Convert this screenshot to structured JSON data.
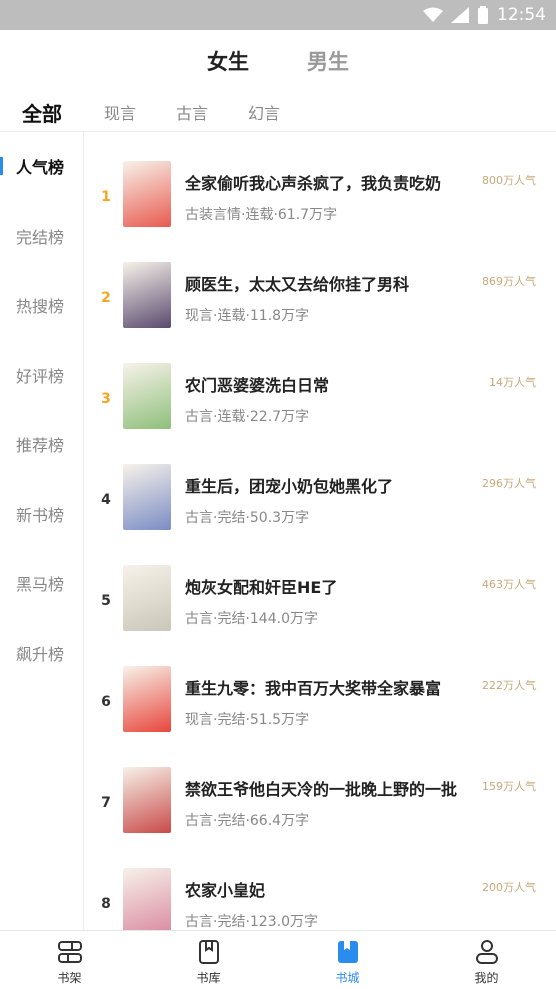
{
  "status": {
    "time": "12:54"
  },
  "gender_tabs": [
    {
      "label": "女生",
      "active": true
    },
    {
      "label": "男生",
      "active": false
    }
  ],
  "categories": [
    {
      "label": "全部",
      "active": true
    },
    {
      "label": "现言",
      "active": false
    },
    {
      "label": "古言",
      "active": false
    },
    {
      "label": "幻言",
      "active": false
    }
  ],
  "sidebar": [
    {
      "label": "人气榜",
      "active": true
    },
    {
      "label": "完结榜",
      "active": false
    },
    {
      "label": "热搜榜",
      "active": false
    },
    {
      "label": "好评榜",
      "active": false
    },
    {
      "label": "推荐榜",
      "active": false
    },
    {
      "label": "新书榜",
      "active": false
    },
    {
      "label": "黑马榜",
      "active": false
    },
    {
      "label": "飙升榜",
      "active": false
    }
  ],
  "books": [
    {
      "rank": "1",
      "title": "全家偷听我心声杀疯了，我负责吃奶",
      "meta": "古装言情·连载·61.7万字",
      "popularity": "800万人气",
      "cover": "#e85a4f"
    },
    {
      "rank": "2",
      "title": "顾医生，太太又去给你挂了男科",
      "meta": "现言·连载·11.8万字",
      "popularity": "869万人气",
      "cover": "#5a4a6e"
    },
    {
      "rank": "3",
      "title": "农门恶婆婆洗白日常",
      "meta": "古言·连载·22.7万字",
      "popularity": "14万人气",
      "cover": "#8fbf7a"
    },
    {
      "rank": "4",
      "title": "重生后，团宠小奶包她黑化了",
      "meta": "古言·完结·50.3万字",
      "popularity": "296万人气",
      "cover": "#7a8cc4"
    },
    {
      "rank": "5",
      "title": "炮灰女配和奸臣HE了",
      "meta": "古言·完结·144.0万字",
      "popularity": "463万人气",
      "cover": "#c9c7b8"
    },
    {
      "rank": "6",
      "title": "重生九零：我中百万大奖带全家暴富",
      "meta": "现言·完结·51.5万字",
      "popularity": "222万人气",
      "cover": "#e8463c"
    },
    {
      "rank": "7",
      "title": "禁欲王爷他白天冷的一批晚上野的一批",
      "meta": "古言·完结·66.4万字",
      "popularity": "159万人气",
      "cover": "#c84a48"
    },
    {
      "rank": "8",
      "title": "农家小皇妃",
      "meta": "古言·完结·123.0万字",
      "popularity": "200万人气",
      "cover": "#d98aa0"
    }
  ],
  "bottom_nav": [
    {
      "label": "书架",
      "icon": "bookshelf-icon",
      "active": false
    },
    {
      "label": "书库",
      "icon": "library-icon",
      "active": false
    },
    {
      "label": "书城",
      "icon": "bookstore-icon",
      "active": true
    },
    {
      "label": "我的",
      "icon": "profile-icon",
      "active": false
    }
  ],
  "colors": {
    "accent": "#2b8cf0",
    "rank_top": "#f5a623",
    "popularity": "#c8a97a"
  }
}
